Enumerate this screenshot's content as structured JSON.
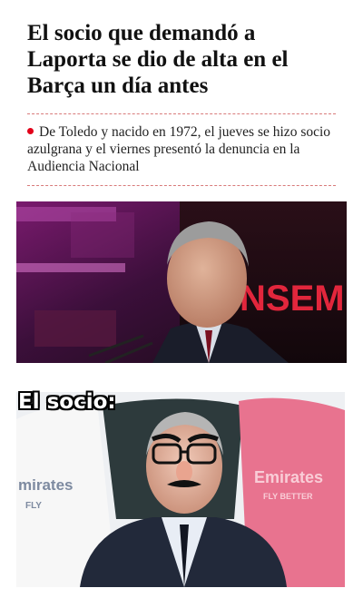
{
  "article": {
    "headline": "El socio que demandó a Laporta se dio de alta en el Barça un día antes",
    "subhead": "De Toledo y nacido en 1972, el jueves se hizo socio azulgrana y el viernes presentó la denuncia en la Audiencia Nacional",
    "accent_color": "#e2001a"
  },
  "photo": {
    "backdrop_text": "NSEM",
    "backdrop_text_2": "E"
  },
  "meme": {
    "caption": "El socio:",
    "shirt_text_left": "mirates",
    "shirt_text_left_2": "FLY",
    "shirt_text_right": "Emirates",
    "shirt_text_right_2": "FLY BETTER"
  }
}
